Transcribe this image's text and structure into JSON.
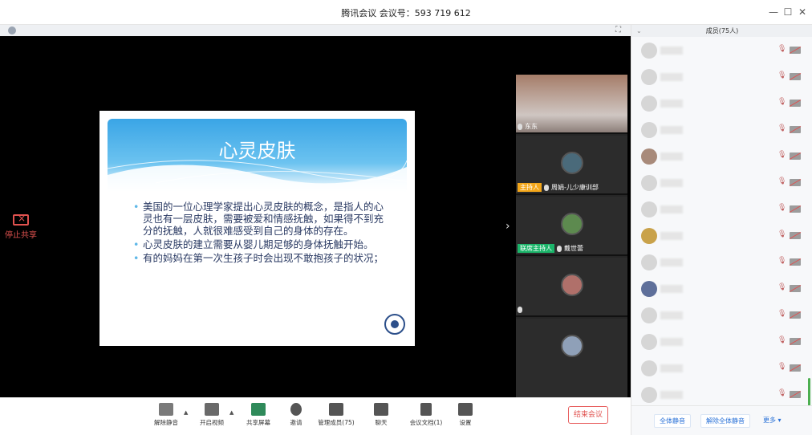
{
  "window": {
    "title": "腾讯会议 会议号：593 719 612",
    "minimize": "—",
    "maximize": "☐",
    "close": "✕"
  },
  "share": {
    "stop_label": "停止共享",
    "fullscreen_icon": "⛶"
  },
  "slide": {
    "title": "心灵皮肤",
    "bullets": [
      "美国的一位心理学家提出心灵皮肤的概念，是指人的心灵也有一层皮肤，需要被爱和情感抚触，如果得不到充分的抚触，人就很难感受到自己的身体的存在。",
      "心灵皮肤的建立需要从婴儿期足够的身体抚触开始。",
      "有的妈妈在第一次生孩子时会出现不敢抱孩子的状况；"
    ]
  },
  "video_tiles": [
    {
      "name": "东东",
      "tag": ""
    },
    {
      "name": "周娟-儿少康训部",
      "tag": "主持人"
    },
    {
      "name": "戴世蕾",
      "tag": "联席主持人"
    },
    {
      "name": "",
      "tag": ""
    },
    {
      "name": "",
      "tag": ""
    }
  ],
  "toolbar": {
    "buttons": [
      {
        "label": "解除静音",
        "icon": "mic-off-icon"
      },
      {
        "label": "开启视频",
        "icon": "camera-off-icon"
      },
      {
        "label": "共享屏幕",
        "icon": "screen-share-icon"
      },
      {
        "label": "邀请",
        "icon": "invite-icon"
      },
      {
        "label": "管理成员(75)",
        "icon": "members-icon"
      },
      {
        "label": "聊天",
        "icon": "chat-icon"
      },
      {
        "label": "会议文档(1)",
        "icon": "document-icon"
      },
      {
        "label": "设置",
        "icon": "settings-icon"
      }
    ],
    "end_label": "结束会议"
  },
  "panel": {
    "title": "成员(75人)",
    "mute_all": "全体静音",
    "unmute_all": "解除全体静音",
    "more": "更多 ▾"
  },
  "colors": {
    "accent": "#2a72d8",
    "danger": "#e0524f",
    "host": "#f3a619",
    "cohost": "#1bb56a"
  }
}
